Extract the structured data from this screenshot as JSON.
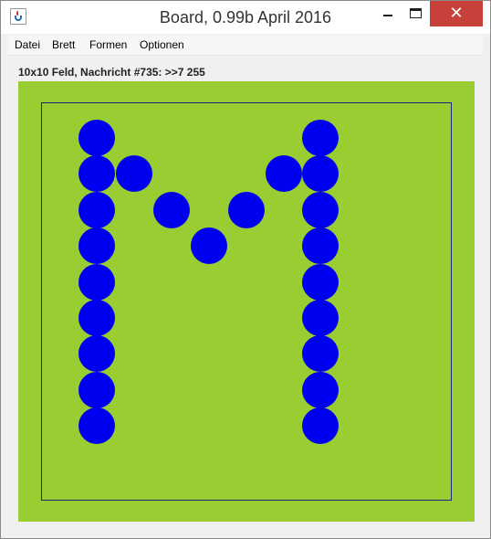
{
  "window": {
    "title": "Board, 0.99b April 2016",
    "close_glyph": "✕",
    "icons": {
      "app": "java-cup-icon",
      "minimize": "minimize-icon",
      "maximize": "maximize-icon",
      "close": "close-icon"
    }
  },
  "menu": {
    "items": [
      {
        "label": "Datei"
      },
      {
        "label": "Brett"
      },
      {
        "label": "Formen"
      },
      {
        "label": "Optionen"
      }
    ]
  },
  "status": {
    "text": "10x10 Feld, Nachricht #735: >>7 255"
  },
  "board": {
    "rows": 10,
    "cols": 10,
    "background": "#9acd32",
    "frame_color": "#1a237e",
    "stone_color": "#0000f0",
    "stones": [
      [
        1,
        1
      ],
      [
        1,
        2
      ],
      [
        1,
        3
      ],
      [
        1,
        4
      ],
      [
        1,
        5
      ],
      [
        1,
        6
      ],
      [
        1,
        7
      ],
      [
        1,
        8
      ],
      [
        1,
        9
      ],
      [
        7,
        1
      ],
      [
        7,
        2
      ],
      [
        7,
        3
      ],
      [
        7,
        4
      ],
      [
        7,
        5
      ],
      [
        7,
        6
      ],
      [
        7,
        7
      ],
      [
        7,
        8
      ],
      [
        7,
        9
      ],
      [
        2,
        2
      ],
      [
        6,
        2
      ],
      [
        3,
        3
      ],
      [
        5,
        3
      ],
      [
        4,
        4
      ]
    ]
  }
}
